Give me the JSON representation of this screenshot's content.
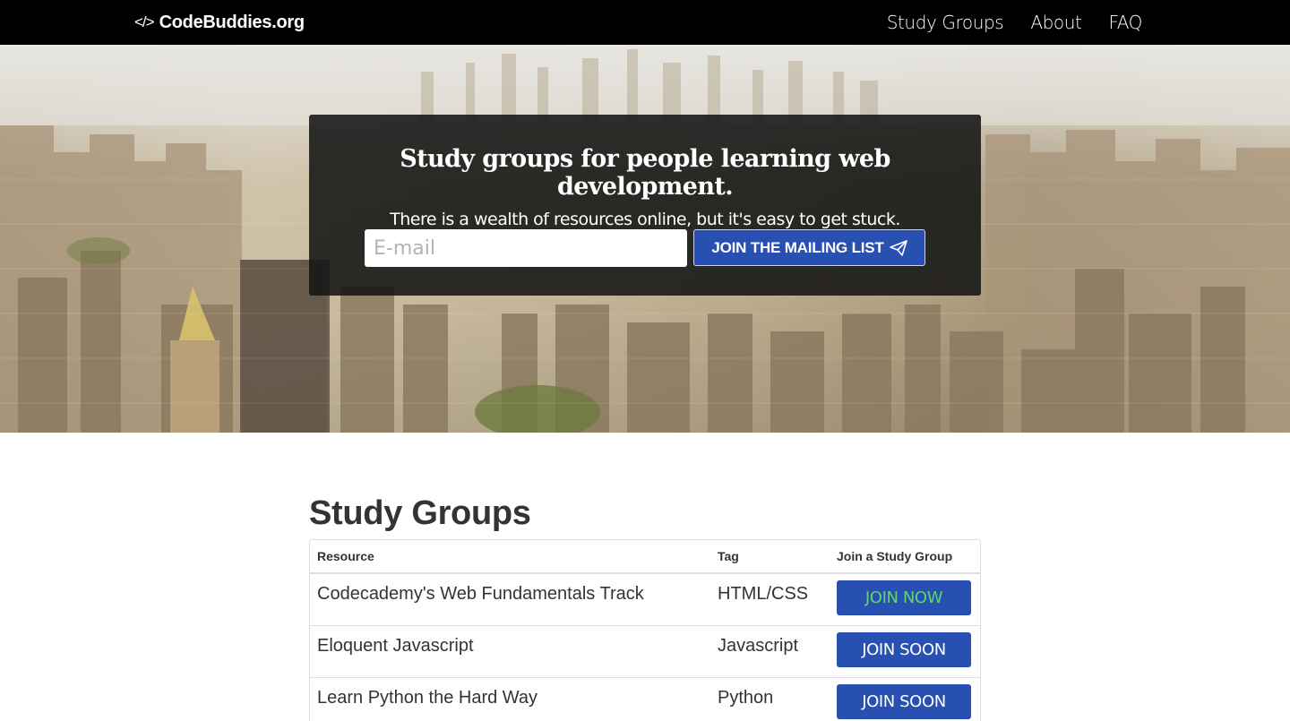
{
  "nav": {
    "brand_icon": "</>",
    "brand_name": "CodeBuddies.org",
    "links": [
      "Study Groups",
      "About",
      "FAQ"
    ]
  },
  "hero": {
    "title": "Study groups for people learning web development.",
    "subtitle": "There is a wealth of resources online, but it's easy to get stuck.",
    "email_placeholder": "E-mail",
    "email_value": "",
    "button_label": "JOIN THE MAILING LIST",
    "button_icon": "paper-plane-icon"
  },
  "study_groups": {
    "heading": "Study Groups",
    "columns": [
      "Resource",
      "Tag",
      "Join a Study Group"
    ],
    "rows": [
      {
        "resource": "Codecademy's Web Fundamentals Track",
        "tag": "HTML/CSS",
        "action": "JOIN NOW"
      },
      {
        "resource": "Eloquent Javascript",
        "tag": "Javascript",
        "action": "JOIN SOON"
      },
      {
        "resource": "Learn Python the Hard Way",
        "tag": "Python",
        "action": "JOIN SOON"
      }
    ]
  },
  "colors": {
    "navbar_bg": "#000000",
    "primary_button": "#2850b2",
    "join_now_text": "#5ed66b",
    "hero_overlay": "rgba(20,20,20,0.88)"
  }
}
